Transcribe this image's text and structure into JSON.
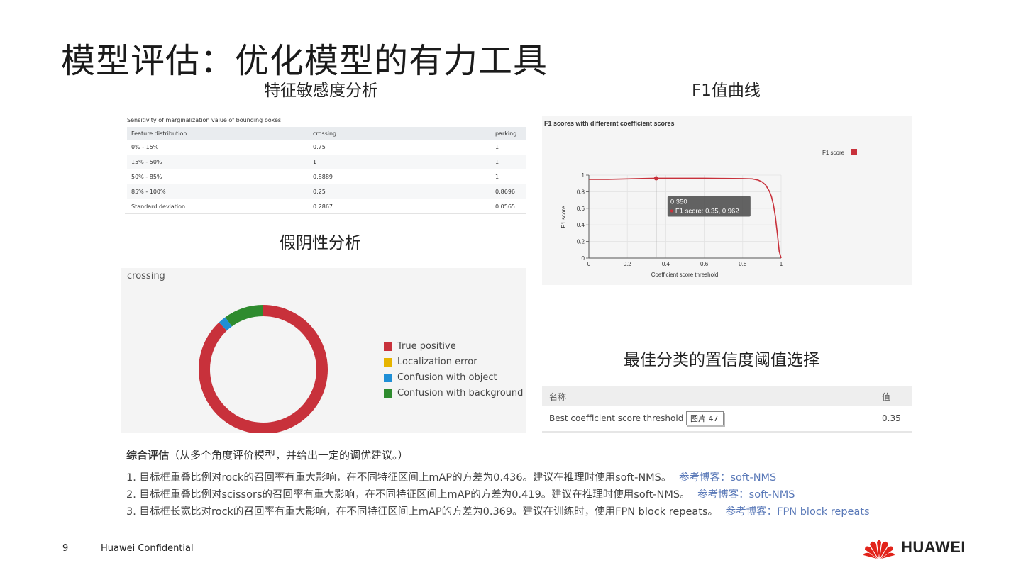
{
  "slide": {
    "title": "模型评估：优化模型的有力工具",
    "page_number": "9",
    "confidential": "Huawei Confidential",
    "logo_text": "HUAWEI"
  },
  "sections": {
    "sensitivity": "特征敏感度分析",
    "f1": "F1值曲线",
    "false_negative": "假阴性分析",
    "threshold": "最佳分类的置信度阈值选择"
  },
  "sensitivity_table": {
    "caption": "Sensitivity of marginalization value of bounding boxes",
    "headers": [
      "Feature distribution",
      "crossing",
      "parking"
    ],
    "rows": [
      [
        "0% - 15%",
        "0.75",
        "1"
      ],
      [
        "15% - 50%",
        "1",
        "1"
      ],
      [
        "50% - 85%",
        "0.8889",
        "1"
      ],
      [
        "85% - 100%",
        "0.25",
        "0.8696"
      ],
      [
        "Standard deviation",
        "0.2867",
        "0.0565"
      ]
    ]
  },
  "chart_data": [
    {
      "type": "line",
      "title": "F1 scores with differernt coefficient scores",
      "xlabel": "Coefficient score threshold",
      "ylabel": "F1 score",
      "xlim": [
        0,
        1
      ],
      "ylim": [
        0,
        1
      ],
      "x_ticks": [
        "0",
        "0.2",
        "0.4",
        "0.6",
        "0.8",
        "1"
      ],
      "y_ticks": [
        "0",
        "0.2",
        "0.4",
        "0.6",
        "0.8",
        "1"
      ],
      "grid": true,
      "legend_position": "top-right",
      "series": [
        {
          "name": "F1 score",
          "color": "#c8313b",
          "x": [
            0,
            0.05,
            0.1,
            0.2,
            0.3,
            0.35,
            0.4,
            0.5,
            0.6,
            0.7,
            0.8,
            0.85,
            0.88,
            0.9,
            0.92,
            0.94,
            0.95,
            0.96,
            0.97,
            0.975,
            0.98,
            0.99,
            1.0
          ],
          "y": [
            0.95,
            0.95,
            0.95,
            0.955,
            0.96,
            0.962,
            0.962,
            0.962,
            0.962,
            0.96,
            0.958,
            0.955,
            0.94,
            0.92,
            0.88,
            0.8,
            0.74,
            0.64,
            0.5,
            0.4,
            0.3,
            0.08,
            0
          ]
        }
      ],
      "tooltip": {
        "header": "0.350",
        "text": "F1 score: 0.35, 0.962",
        "x": 0.35,
        "y": 0.962
      }
    },
    {
      "type": "pie",
      "title": "crossing",
      "donut": true,
      "categories": [
        "True positive",
        "Localization error",
        "Confusion with object",
        "Confusion with background"
      ],
      "values": [
        88,
        0,
        2,
        10
      ],
      "colors": [
        "#c8313b",
        "#e6b400",
        "#1f8fd6",
        "#2e8b2e"
      ],
      "legend_position": "right"
    }
  ],
  "threshold_table": {
    "headers": [
      "名称",
      "值"
    ],
    "row": {
      "name": "Best coefficient score threshold",
      "value": "0.35"
    },
    "tag": "图片 47"
  },
  "summary": {
    "head_bold": "综合评估",
    "head_rest": "（从多个角度评价模型，并给出一定的调优建议。）",
    "items": [
      {
        "text": "1. 目标框重叠比例对rock的召回率有重大影响，在不同特征区间上mAP的方差为0.436。建议在推理时使用soft-NMS。",
        "blog": "参考博客：soft-NMS"
      },
      {
        "text": "2. 目标框重叠比例对scissors的召回率有重大影响，在不同特征区间上mAP的方差为0.419。建议在推理时使用soft-NMS。",
        "blog": "参考博客：soft-NMS"
      },
      {
        "text": "3. 目标框长宽比对rock的召回率有重大影响，在不同特征区间上mAP的方差为0.369。建议在训练时，使用FPN block repeats。",
        "blog": "参考博客：FPN block repeats"
      }
    ]
  }
}
